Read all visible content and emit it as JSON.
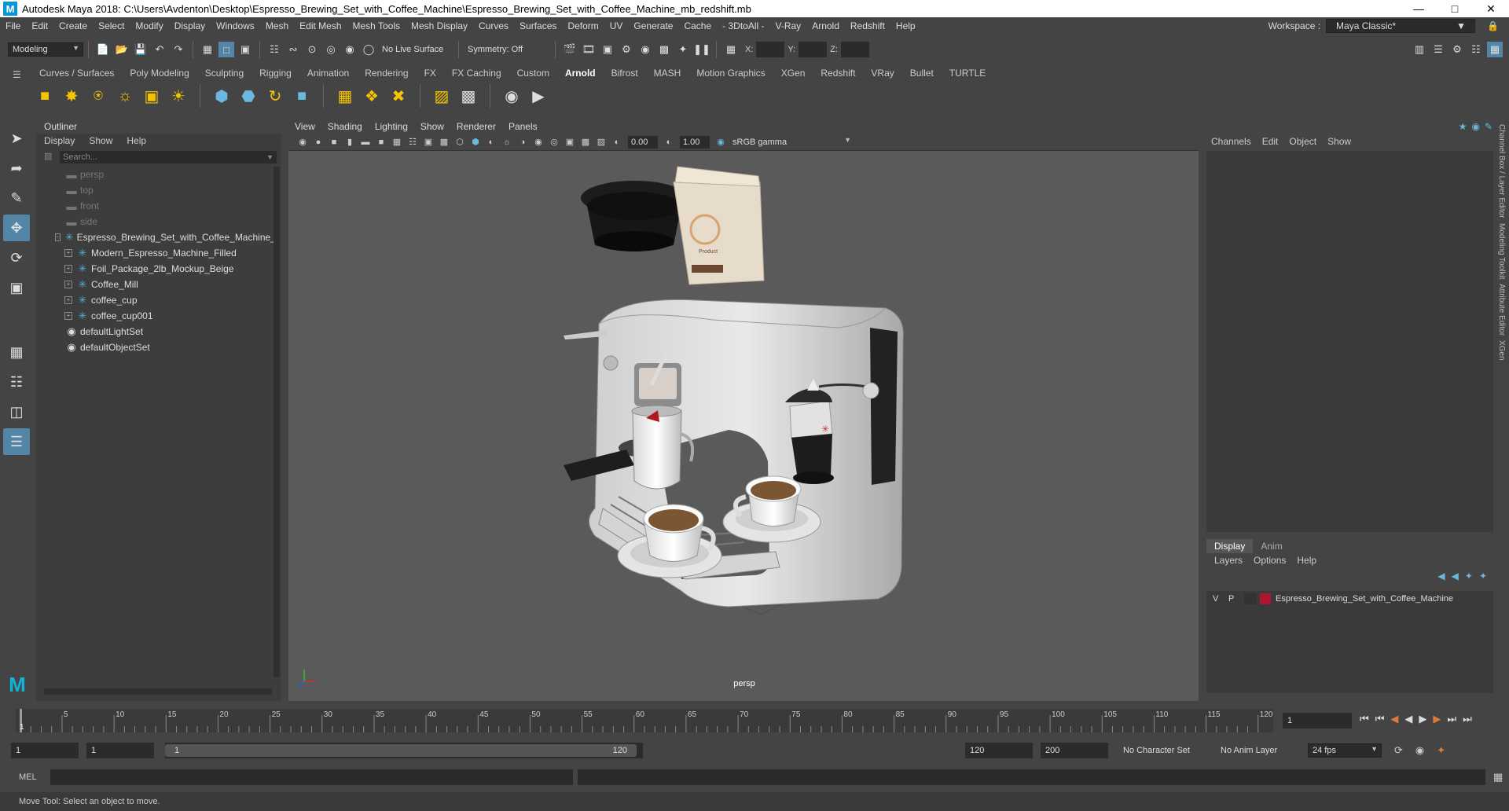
{
  "title": "Autodesk Maya 2018: C:\\Users\\Avdenton\\Desktop\\Espresso_Brewing_Set_with_Coffee_Machine\\Espresso_Brewing_Set_with_Coffee_Machine_mb_redshift.mb",
  "menu": [
    "File",
    "Edit",
    "Create",
    "Select",
    "Modify",
    "Display",
    "Windows",
    "Mesh",
    "Edit Mesh",
    "Mesh Tools",
    "Mesh Display",
    "Curves",
    "Surfaces",
    "Deform",
    "UV",
    "Generate",
    "Cache",
    "- 3DtoAll -",
    "V-Ray",
    "Arnold",
    "Redshift",
    "Help"
  ],
  "workspace": {
    "label": "Workspace :",
    "value": "Maya Classic*"
  },
  "status": {
    "mode": "Modeling",
    "live_surface": "No Live Surface",
    "symmetry": "Symmetry: Off",
    "x": "X:",
    "y": "Y:",
    "z": "Z:"
  },
  "shelf_tabs": [
    "Curves / Surfaces",
    "Poly Modeling",
    "Sculpting",
    "Rigging",
    "Animation",
    "Rendering",
    "FX",
    "FX Caching",
    "Custom",
    "Arnold",
    "Bifrost",
    "MASH",
    "Motion Graphics",
    "XGen",
    "Redshift",
    "VRay",
    "Bullet",
    "TURTLE"
  ],
  "shelf_active": "Arnold",
  "outliner": {
    "title": "Outliner",
    "menu": [
      "Display",
      "Show",
      "Help"
    ],
    "search_placeholder": "Search...",
    "items": [
      {
        "label": "persp",
        "dim": true
      },
      {
        "label": "top",
        "dim": true
      },
      {
        "label": "front",
        "dim": true
      },
      {
        "label": "side",
        "dim": true
      },
      {
        "label": "Espresso_Brewing_Set_with_Coffee_Machine_"
      },
      {
        "label": "Modern_Espresso_Machine_Filled"
      },
      {
        "label": "Foil_Package_2lb_Mockup_Beige"
      },
      {
        "label": "Coffee_Mill"
      },
      {
        "label": "coffee_cup"
      },
      {
        "label": "coffee_cup001"
      },
      {
        "label": "defaultLightSet"
      },
      {
        "label": "defaultObjectSet"
      }
    ]
  },
  "viewport": {
    "menu": [
      "View",
      "Shading",
      "Lighting",
      "Show",
      "Renderer",
      "Panels"
    ],
    "exposure": "0.00",
    "gamma": "1.00",
    "colorspace": "sRGB gamma",
    "camera": "persp"
  },
  "channel_box": {
    "menu": [
      "Channels",
      "Edit",
      "Object",
      "Show"
    ],
    "tabs": [
      "Display",
      "Anim"
    ],
    "layer_menu": [
      "Layers",
      "Options",
      "Help"
    ],
    "layer": {
      "v": "V",
      "p": "P",
      "name": "Espresso_Brewing_Set_with_Coffee_Machine",
      "color": "#b01530"
    }
  },
  "side_tabs": [
    "Channel Box / Layer Editor",
    "Modeling Toolkit",
    "Attribute Editor",
    "XGen"
  ],
  "timeline": {
    "ticks": [
      "5",
      "10",
      "15",
      "20",
      "25",
      "30",
      "35",
      "40",
      "45",
      "50",
      "55",
      "60",
      "65",
      "70",
      "75",
      "80",
      "85",
      "90",
      "95",
      "100",
      "105",
      "110",
      "115",
      "120"
    ],
    "current": "1",
    "current_marker": "1"
  },
  "range": {
    "start": "1",
    "start2": "1",
    "slider_start": "1",
    "slider_end": "120",
    "end": "120",
    "end2": "200",
    "character_set": "No Character Set",
    "anim_layer": "No Anim Layer",
    "fps": "24 fps"
  },
  "mel_label": "MEL",
  "help_line": "Move Tool: Select an object to move."
}
